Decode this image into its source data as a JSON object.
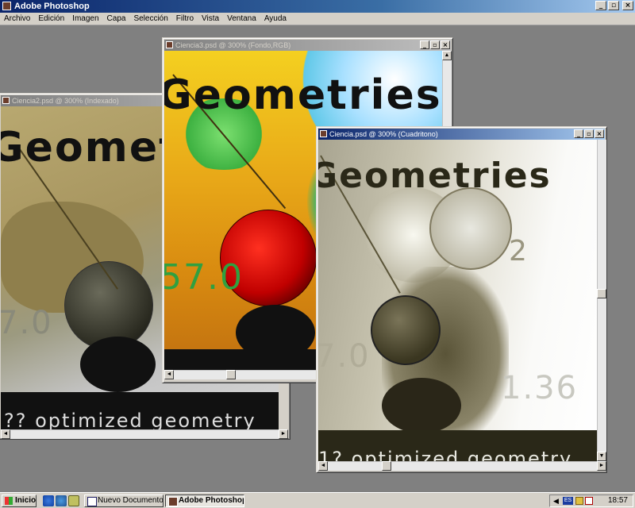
{
  "app": {
    "title": "Adobe Photoshop"
  },
  "menu": [
    "Archivo",
    "Edición",
    "Imagen",
    "Capa",
    "Selección",
    "Filtro",
    "Vista",
    "Ventana",
    "Ayuda"
  ],
  "window_controls": {
    "minimize": "_",
    "restore": "▫",
    "close": "×"
  },
  "documents": [
    {
      "title": "Ciencia2.psd @ 300% (Indexado)",
      "heading": "Geomet",
      "caption": "?? optimized geometry",
      "digits": "7.0"
    },
    {
      "title": "Ciencia3.psd @ 300% (Fondo,RGB)",
      "heading": "Geometries",
      "digits": "57.0"
    },
    {
      "title": "Ciencia.psd @ 300% (Cuadritono)",
      "heading": "Geometries",
      "caption": "1? optimized geometry",
      "digits": "7.0",
      "digits2": "1.36",
      "digits3": "2"
    }
  ],
  "taskbar": {
    "start_label": "Inicio",
    "tasks": [
      {
        "label": "Nuevo Documento...",
        "active": false
      },
      {
        "label": "Adobe Photoshop",
        "active": true
      }
    ],
    "language": "ES",
    "clock": "18:57"
  }
}
